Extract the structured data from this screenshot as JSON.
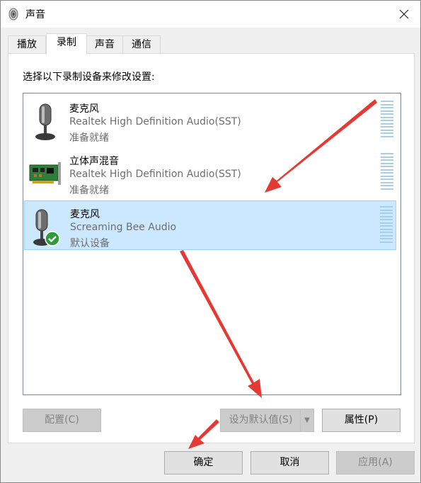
{
  "window": {
    "title": "声音"
  },
  "tabs": [
    {
      "label": "播放"
    },
    {
      "label": "录制"
    },
    {
      "label": "声音"
    },
    {
      "label": "通信"
    }
  ],
  "panel": {
    "instruction": "选择以下录制设备来修改设置:"
  },
  "devices": [
    {
      "name": "麦克风",
      "description": "Realtek High Definition Audio(SST)",
      "status": "准备就绪",
      "icon": "microphone-icon"
    },
    {
      "name": "立体声混音",
      "description": "Realtek High Definition Audio(SST)",
      "status": "准备就绪",
      "icon": "sound-card-icon"
    },
    {
      "name": "麦克风",
      "description": "Screaming Bee Audio",
      "status": "默认设备",
      "icon": "microphone-icon",
      "selected": true,
      "default": true
    }
  ],
  "buttons": {
    "configure": "配置(C)",
    "set_default": "设为默认值(S)",
    "properties": "属性(P)",
    "ok": "确定",
    "cancel": "取消",
    "apply": "应用(A)"
  },
  "colors": {
    "selection": "#cce8ff",
    "arrow": "#e53935",
    "check": "#2e9b3a"
  }
}
